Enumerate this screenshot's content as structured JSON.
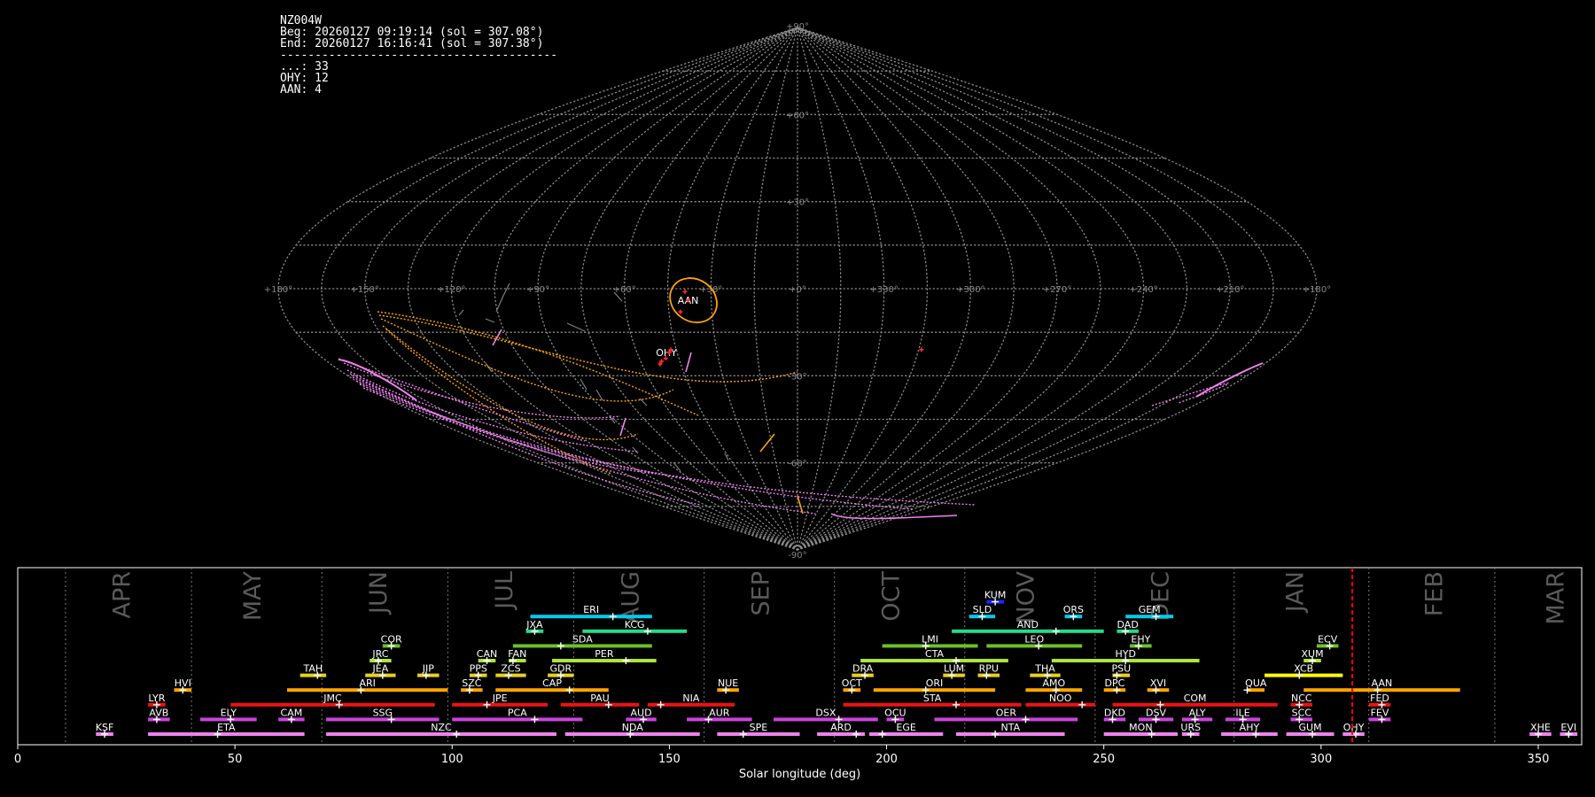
{
  "info": {
    "lines": [
      "NZ004W",
      "Beg: 20260127 09:19:14 (sol = 307.08°)",
      "End: 20260127 16:16:41 (sol = 307.38°)",
      "----------------------------------------",
      "...: 33",
      "OHY: 12",
      "AAN: 4"
    ]
  },
  "colors": {
    "background": "#000000",
    "grid": "#8a8a8a",
    "AAN": "#ffa500",
    "OHY": "#ee82ee",
    "sporadic": "#7f7f7f",
    "current_sol_line": "#ff0000"
  },
  "chart_data": [
    {
      "type": "scatter",
      "projection": "sinusoidal",
      "grid": true,
      "meridian_labels": [
        "+180°",
        "+150°",
        "+120°",
        "+90°",
        "+60°",
        "+30°",
        "+0°",
        "+330°",
        "+300°",
        "+270°",
        "+240°",
        "+210°",
        "+180°"
      ],
      "meridian_values": [
        180,
        150,
        120,
        90,
        60,
        30,
        0,
        330,
        300,
        270,
        240,
        210,
        180
      ],
      "parallel_labels": [
        "+90°",
        "+60°",
        "+30°",
        "-30°",
        "-60°",
        "-90°"
      ],
      "parallel_values": [
        90,
        60,
        30,
        -30,
        -60,
        -90
      ],
      "shower_labels": [
        {
          "name": "AAN",
          "ra": 142,
          "dec": -4,
          "circle_radius_deg": 10
        },
        {
          "name": "OHY",
          "ra": 131,
          "dec": -22
        }
      ],
      "radiants": [
        {
          "ra": 142,
          "dec": -4
        },
        {
          "ra": 141,
          "dec": -1
        },
        {
          "ra": 139,
          "dec": -8
        },
        {
          "ra": 133,
          "dec": -21
        },
        {
          "ra": 132,
          "dec": -22
        },
        {
          "ra": 130,
          "dec": -24
        },
        {
          "ra": 128,
          "dec": -25
        },
        {
          "ra": 127,
          "dec": -26
        },
        {
          "ra": 226,
          "dec": -21
        }
      ]
    },
    {
      "type": "bar",
      "orientation": "horizontal-ranges",
      "xlabel": "Solar longitude (deg)",
      "xlim": [
        0,
        360
      ],
      "xticks": [
        0,
        50,
        100,
        150,
        200,
        250,
        300,
        350
      ],
      "current_sol": 307.2,
      "months": [
        {
          "name": "APR",
          "boundary": 11,
          "label_x": 24
        },
        {
          "name": "MAY",
          "boundary": 40,
          "label_x": 54
        },
        {
          "name": "JUN",
          "boundary": 70,
          "label_x": 83
        },
        {
          "name": "JUL",
          "boundary": 99,
          "label_x": 112
        },
        {
          "name": "AUG",
          "boundary": 128,
          "label_x": 141
        },
        {
          "name": "SEP",
          "boundary": 158,
          "label_x": 171
        },
        {
          "name": "OCT",
          "boundary": 188,
          "label_x": 201
        },
        {
          "name": "NOV",
          "boundary": 218,
          "label_x": 232
        },
        {
          "name": "DEC",
          "boundary": 248,
          "label_x": 263
        },
        {
          "name": "JAN",
          "boundary": 280,
          "label_x": 294
        },
        {
          "name": "FEB",
          "boundary": 311,
          "label_x": 326
        },
        {
          "name": "MAR",
          "boundary": 340,
          "label_x": 354
        }
      ],
      "showers": [
        {
          "name": "KSF",
          "start": 18,
          "end": 22,
          "peak": 20,
          "row": 0,
          "color": "#ee82ee"
        },
        {
          "name": "ETA",
          "start": 30,
          "end": 66,
          "peak": 46,
          "row": 0,
          "color": "#ee82ee"
        },
        {
          "name": "NZC",
          "start": 71,
          "end": 124,
          "peak": 101,
          "row": 0,
          "color": "#ee82ee"
        },
        {
          "name": "NDA",
          "start": 126,
          "end": 157,
          "peak": 141,
          "row": 0,
          "color": "#ee82ee"
        },
        {
          "name": "SPE",
          "start": 161,
          "end": 180,
          "peak": 167,
          "row": 0,
          "color": "#ee82ee"
        },
        {
          "name": "ARD",
          "start": 184,
          "end": 195,
          "peak": 193,
          "row": 0,
          "color": "#ee82ee"
        },
        {
          "name": "EGE",
          "start": 196,
          "end": 213,
          "peak": 199,
          "row": 0,
          "color": "#ee82ee"
        },
        {
          "name": "NTA",
          "start": 216,
          "end": 241,
          "peak": 225,
          "row": 0,
          "color": "#ee82ee"
        },
        {
          "name": "MON",
          "start": 250,
          "end": 267,
          "peak": 261,
          "row": 0,
          "color": "#ee82ee"
        },
        {
          "name": "URS",
          "start": 268,
          "end": 272,
          "peak": 270,
          "row": 0,
          "color": "#ee82ee"
        },
        {
          "name": "AHY",
          "start": 277,
          "end": 290,
          "peak": 285,
          "row": 0,
          "color": "#ee82ee"
        },
        {
          "name": "GUM",
          "start": 292,
          "end": 303,
          "peak": 298,
          "row": 0,
          "color": "#ee82ee"
        },
        {
          "name": "OHY",
          "start": 305,
          "end": 310,
          "peak": 308,
          "row": 0,
          "color": "#ee82ee"
        },
        {
          "name": "XHE",
          "start": 348,
          "end": 353,
          "peak": 350,
          "row": 0,
          "color": "#ee82ee"
        },
        {
          "name": "EVI",
          "start": 355,
          "end": 359,
          "peak": 357,
          "row": 0,
          "color": "#ee82ee"
        },
        {
          "name": "AVB",
          "start": 30,
          "end": 35,
          "peak": 32,
          "row": 1,
          "color": "#cc44dd"
        },
        {
          "name": "ELY",
          "start": 42,
          "end": 55,
          "peak": 49,
          "row": 1,
          "color": "#cc44dd"
        },
        {
          "name": "CAM",
          "start": 60,
          "end": 66,
          "peak": 63,
          "row": 1,
          "color": "#cc44dd"
        },
        {
          "name": "SSG",
          "start": 71,
          "end": 97,
          "peak": 86,
          "row": 1,
          "color": "#cc44dd"
        },
        {
          "name": "PCA",
          "start": 100,
          "end": 130,
          "peak": 119,
          "row": 1,
          "color": "#cc44dd"
        },
        {
          "name": "AUD",
          "start": 140,
          "end": 147,
          "peak": 144,
          "row": 1,
          "color": "#cc44dd"
        },
        {
          "name": "AUR",
          "start": 154,
          "end": 169,
          "peak": 159,
          "row": 1,
          "color": "#cc44dd"
        },
        {
          "name": "DSX",
          "start": 174,
          "end": 198,
          "peak": 189,
          "row": 1,
          "color": "#cc44dd"
        },
        {
          "name": "OCU",
          "start": 200,
          "end": 204,
          "peak": 202,
          "row": 1,
          "color": "#cc44dd"
        },
        {
          "name": "OER",
          "start": 211,
          "end": 244,
          "peak": 232,
          "row": 1,
          "color": "#cc44dd"
        },
        {
          "name": "DKD",
          "start": 250,
          "end": 255,
          "peak": 252,
          "row": 1,
          "color": "#cc44dd"
        },
        {
          "name": "DSV",
          "start": 258,
          "end": 266,
          "peak": 262,
          "row": 1,
          "color": "#cc44dd"
        },
        {
          "name": "ALY",
          "start": 268,
          "end": 275,
          "peak": 271,
          "row": 1,
          "color": "#cc44dd"
        },
        {
          "name": "ILE",
          "start": 278,
          "end": 286,
          "peak": 282,
          "row": 1,
          "color": "#cc44dd"
        },
        {
          "name": "SCC",
          "start": 293,
          "end": 298,
          "peak": 295,
          "row": 1,
          "color": "#cc44dd"
        },
        {
          "name": "FEV",
          "start": 311,
          "end": 316,
          "peak": 314,
          "row": 1,
          "color": "#cc44dd"
        },
        {
          "name": "LYR",
          "start": 30,
          "end": 34,
          "peak": 32,
          "row": 2,
          "color": "#ee1111"
        },
        {
          "name": "JMC",
          "start": 49,
          "end": 96,
          "peak": 74,
          "row": 2,
          "color": "#ee1111"
        },
        {
          "name": "JPE",
          "start": 100,
          "end": 122,
          "peak": 108,
          "row": 2,
          "color": "#ee1111"
        },
        {
          "name": "PAU",
          "start": 125,
          "end": 143,
          "peak": 136,
          "row": 2,
          "color": "#ee1111"
        },
        {
          "name": "NIA",
          "start": 145,
          "end": 165,
          "peak": 148,
          "row": 2,
          "color": "#ee1111"
        },
        {
          "name": "STA",
          "start": 190,
          "end": 231,
          "peak": 216,
          "row": 2,
          "color": "#ee1111"
        },
        {
          "name": "NOO",
          "start": 232,
          "end": 248,
          "peak": 245,
          "row": 2,
          "color": "#ee1111"
        },
        {
          "name": "COM",
          "start": 252,
          "end": 290,
          "peak": 263,
          "row": 2,
          "color": "#ee1111"
        },
        {
          "name": "NCC",
          "start": 293,
          "end": 298,
          "peak": 295,
          "row": 2,
          "color": "#ee1111"
        },
        {
          "name": "FED",
          "start": 311,
          "end": 316,
          "peak": 314,
          "row": 2,
          "color": "#ee1111"
        },
        {
          "name": "HVI",
          "start": 36,
          "end": 40,
          "peak": 38,
          "row": 3,
          "color": "#ffa500"
        },
        {
          "name": "ARI",
          "start": 62,
          "end": 99,
          "peak": 79,
          "row": 3,
          "color": "#ffa500"
        },
        {
          "name": "SZC",
          "start": 102,
          "end": 107,
          "peak": 104,
          "row": 3,
          "color": "#ffa500"
        },
        {
          "name": "CAP",
          "start": 110,
          "end": 136,
          "peak": 127,
          "row": 3,
          "color": "#ffa500"
        },
        {
          "name": "NUE",
          "start": 161,
          "end": 166,
          "peak": 163,
          "row": 3,
          "color": "#ffa500"
        },
        {
          "name": "OCT",
          "start": 190,
          "end": 194,
          "peak": 192,
          "row": 3,
          "color": "#ffa500"
        },
        {
          "name": "ORI",
          "start": 197,
          "end": 225,
          "peak": 209,
          "row": 3,
          "color": "#ffa500"
        },
        {
          "name": "AMO",
          "start": 232,
          "end": 245,
          "peak": 239,
          "row": 3,
          "color": "#ffa500"
        },
        {
          "name": "DPC",
          "start": 250,
          "end": 255,
          "peak": 253,
          "row": 3,
          "color": "#ffa500"
        },
        {
          "name": "XVI",
          "start": 260,
          "end": 265,
          "peak": 262,
          "row": 3,
          "color": "#ffa500"
        },
        {
          "name": "QUA",
          "start": 283,
          "end": 287,
          "peak": 283,
          "row": 3,
          "color": "#ffa500"
        },
        {
          "name": "AAN",
          "start": 296,
          "end": 332,
          "peak": 313,
          "row": 3,
          "color": "#ffa500"
        },
        {
          "name": "TAH",
          "start": 65,
          "end": 71,
          "peak": 69,
          "row": 4,
          "color": "#e8d020"
        },
        {
          "name": "JEA",
          "start": 80,
          "end": 87,
          "peak": 84,
          "row": 4,
          "color": "#e8d020"
        },
        {
          "name": "JIP",
          "start": 92,
          "end": 97,
          "peak": 94,
          "row": 4,
          "color": "#e8d020"
        },
        {
          "name": "PPS",
          "start": 104,
          "end": 108,
          "peak": 106,
          "row": 4,
          "color": "#e8d020"
        },
        {
          "name": "ZCS",
          "start": 110,
          "end": 117,
          "peak": 113,
          "row": 4,
          "color": "#e8d020"
        },
        {
          "name": "GDR",
          "start": 122,
          "end": 128,
          "peak": 125,
          "row": 4,
          "color": "#e8d020"
        },
        {
          "name": "DRA",
          "start": 192,
          "end": 197,
          "peak": 195,
          "row": 4,
          "color": "#e8d020"
        },
        {
          "name": "LUM",
          "start": 213,
          "end": 218,
          "peak": 215,
          "row": 4,
          "color": "#e8d020"
        },
        {
          "name": "RPU",
          "start": 221,
          "end": 226,
          "peak": 223,
          "row": 4,
          "color": "#e8d020"
        },
        {
          "name": "THA",
          "start": 233,
          "end": 240,
          "peak": 237,
          "row": 4,
          "color": "#e8d020"
        },
        {
          "name": "PSU",
          "start": 252,
          "end": 256,
          "peak": 253,
          "row": 4,
          "color": "#e8d020"
        },
        {
          "name": "XCB",
          "start": 287,
          "end": 305,
          "peak": 295,
          "row": 4,
          "color": "#ffff00"
        },
        {
          "name": "JRC",
          "start": 81,
          "end": 86,
          "peak": 83,
          "row": 5,
          "color": "#aee436"
        },
        {
          "name": "CAN",
          "start": 106,
          "end": 110,
          "peak": 108,
          "row": 5,
          "color": "#aee436"
        },
        {
          "name": "FAN",
          "start": 113,
          "end": 117,
          "peak": 114,
          "row": 5,
          "color": "#aee436"
        },
        {
          "name": "PER",
          "start": 123,
          "end": 147,
          "peak": 140,
          "row": 5,
          "color": "#aee436"
        },
        {
          "name": "CTA",
          "start": 194,
          "end": 228,
          "peak": 216,
          "row": 5,
          "color": "#aee436"
        },
        {
          "name": "HYD",
          "start": 238,
          "end": 272,
          "peak": 255,
          "row": 5,
          "color": "#aee436"
        },
        {
          "name": "XUM",
          "start": 296,
          "end": 300,
          "peak": 298,
          "row": 5,
          "color": "#aee436"
        },
        {
          "name": "COR",
          "start": 84,
          "end": 88,
          "peak": 86,
          "row": 6,
          "color": "#6cc02a"
        },
        {
          "name": "SDA",
          "start": 114,
          "end": 146,
          "peak": 125,
          "row": 6,
          "color": "#6cc02a"
        },
        {
          "name": "LMI",
          "start": 199,
          "end": 221,
          "peak": 209,
          "row": 6,
          "color": "#6cc02a"
        },
        {
          "name": "LEO",
          "start": 223,
          "end": 245,
          "peak": 235,
          "row": 6,
          "color": "#6cc02a"
        },
        {
          "name": "EHY",
          "start": 256,
          "end": 261,
          "peak": 258,
          "row": 6,
          "color": "#6cc02a"
        },
        {
          "name": "ECV",
          "start": 299,
          "end": 304,
          "peak": 302,
          "row": 6,
          "color": "#6cc02a"
        },
        {
          "name": "JXA",
          "start": 117,
          "end": 121,
          "peak": 119,
          "row": 7,
          "color": "#22dd88"
        },
        {
          "name": "KCG",
          "start": 130,
          "end": 154,
          "peak": 145,
          "row": 7,
          "color": "#22dd88"
        },
        {
          "name": "AND",
          "start": 215,
          "end": 250,
          "peak": 239,
          "row": 7,
          "color": "#22dd88"
        },
        {
          "name": "DAD",
          "start": 253,
          "end": 258,
          "peak": 255,
          "row": 7,
          "color": "#22dd88"
        },
        {
          "name": "ERI",
          "start": 118,
          "end": 146,
          "peak": 137,
          "row": 8,
          "color": "#00ccee"
        },
        {
          "name": "SLD",
          "start": 219,
          "end": 225,
          "peak": 222,
          "row": 8,
          "color": "#00ccee"
        },
        {
          "name": "ORS",
          "start": 241,
          "end": 245,
          "peak": 243,
          "row": 8,
          "color": "#00ccee"
        },
        {
          "name": "GEM",
          "start": 255,
          "end": 266,
          "peak": 262,
          "row": 8,
          "color": "#00ccee"
        },
        {
          "name": "KUM",
          "start": 223,
          "end": 227,
          "peak": 225,
          "row": 9,
          "color": "#1a2aff"
        }
      ]
    }
  ]
}
